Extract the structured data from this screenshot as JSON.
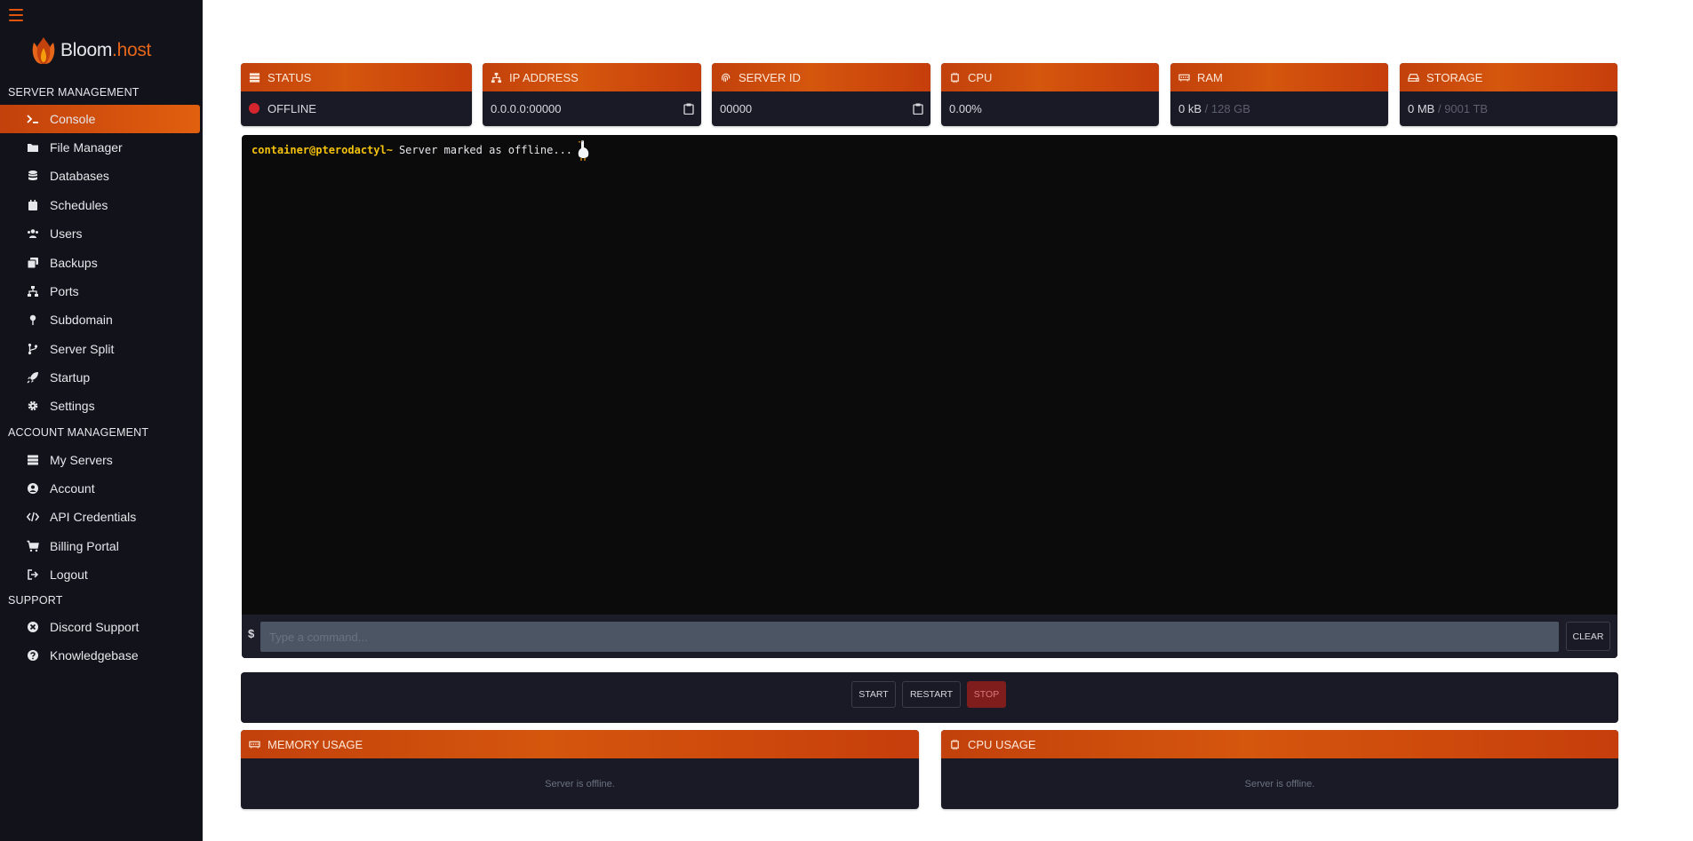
{
  "brand": {
    "name_main": "Bloom",
    "name_dot": ".host"
  },
  "sidebar": {
    "sections": [
      {
        "label": "SERVER MANAGEMENT"
      },
      {
        "label": "ACCOUNT MANAGEMENT"
      },
      {
        "label": "SUPPORT"
      }
    ],
    "items": [
      {
        "label": "Console",
        "icon": "terminal-icon",
        "active": true
      },
      {
        "label": "File Manager",
        "icon": "folder-icon"
      },
      {
        "label": "Databases",
        "icon": "database-icon"
      },
      {
        "label": "Schedules",
        "icon": "calendar-icon"
      },
      {
        "label": "Users",
        "icon": "users-icon"
      },
      {
        "label": "Backups",
        "icon": "backup-icon"
      },
      {
        "label": "Ports",
        "icon": "network-icon"
      },
      {
        "label": "Subdomain",
        "icon": "pin-icon"
      },
      {
        "label": "Server Split",
        "icon": "split-icon"
      },
      {
        "label": "Startup",
        "icon": "rocket-icon"
      },
      {
        "label": "Settings",
        "icon": "gear-icon"
      },
      {
        "label": "My Servers",
        "icon": "server-icon"
      },
      {
        "label": "Account",
        "icon": "user-circle-icon"
      },
      {
        "label": "API Credentials",
        "icon": "code-icon"
      },
      {
        "label": "Billing Portal",
        "icon": "cart-icon"
      },
      {
        "label": "Logout",
        "icon": "logout-icon"
      },
      {
        "label": "Discord Support",
        "icon": "discord-icon"
      },
      {
        "label": "Knowledgebase",
        "icon": "question-icon"
      }
    ]
  },
  "stats": {
    "status": {
      "title": "STATUS",
      "value": "OFFLINE"
    },
    "ip": {
      "title": "IP ADDRESS",
      "value": "0.0.0.0:00000"
    },
    "server_id": {
      "title": "SERVER ID",
      "value": "00000"
    },
    "cpu": {
      "title": "CPU",
      "value": "0.00%"
    },
    "ram": {
      "title": "RAM",
      "value": "0 kB",
      "limit": "/ 128 GB"
    },
    "storage": {
      "title": "STORAGE",
      "value": "0 MB",
      "limit": "/ 9001 TB"
    }
  },
  "console": {
    "prompt": "container@pterodactyl~",
    "message": "Server marked as offline...",
    "input_prefix": "$",
    "input_placeholder": "Type a command...",
    "clear_label": "CLEAR"
  },
  "power": {
    "start": "START",
    "restart": "RESTART",
    "stop": "STOP"
  },
  "graphs": {
    "memory": {
      "title": "MEMORY USAGE",
      "message": "Server is offline."
    },
    "cpu": {
      "title": "CPU USAGE",
      "message": "Server is offline."
    }
  },
  "colors": {
    "accent": "#d5560d",
    "sidebar_bg": "#12131a",
    "card_bg": "#191a26",
    "console_bg": "#0b0b0b",
    "offline_dot": "#d5252f",
    "prompt": "#f4c20d"
  }
}
